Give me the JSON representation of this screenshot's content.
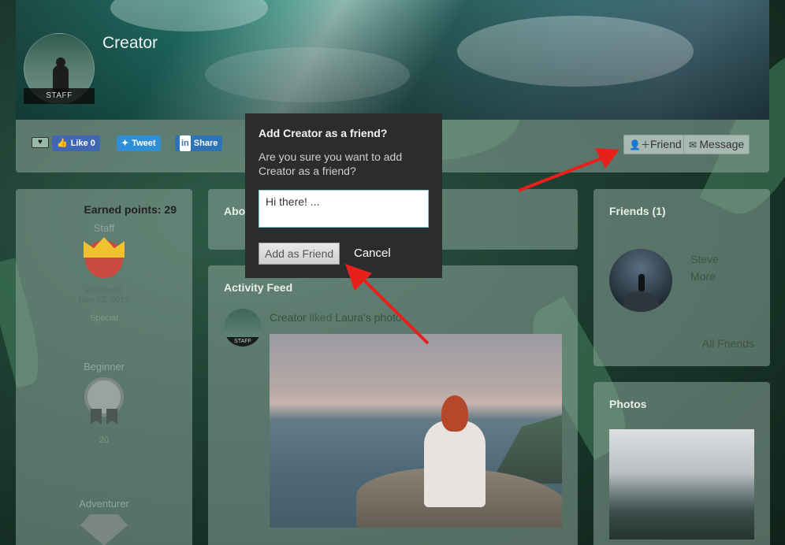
{
  "profile": {
    "name": "Creator",
    "role_badge": "STAFF"
  },
  "social": {
    "like_label": "Like 0",
    "tweet_label": "Tweet",
    "share_label": "Share",
    "heart_icon": "heart-icon",
    "fb_icon": "facebook-icon",
    "twitter_icon": "twitter-icon",
    "linkedin_icon": "linkedin-icon"
  },
  "actions": {
    "friend_label": "Friend",
    "message_label": "Message"
  },
  "left": {
    "earned_points": "Earned points: 29",
    "badges": [
      {
        "title": "Staff",
        "received_label": "Received:",
        "date": "Nov 22, 2019",
        "tag": "Special"
      },
      {
        "title": "Beginner",
        "points": "20"
      },
      {
        "title": "Adventurer"
      }
    ]
  },
  "about": {
    "title": "Abo"
  },
  "feed": {
    "title": "Activity Feed",
    "item_actor": "Creator",
    "item_verb": " liked ",
    "item_object": "Laura's photo",
    "avatar_badge": "STAFF"
  },
  "friends": {
    "title": "Friends (1)",
    "friend_first": "Steve",
    "friend_last": "More",
    "all_label": "All Friends"
  },
  "photos": {
    "title": "Photos"
  },
  "modal": {
    "title": "Add Creator as a friend?",
    "text": "Are you sure you want to add Creator as a friend?",
    "input_value": "Hi there! ...",
    "add_label": "Add as Friend",
    "cancel_label": "Cancel"
  },
  "colors": {
    "annotation_arrow": "#e8201c",
    "facebook": "#4267b2",
    "twitter": "#2f8fd6",
    "linkedin": "#2d73b6"
  }
}
